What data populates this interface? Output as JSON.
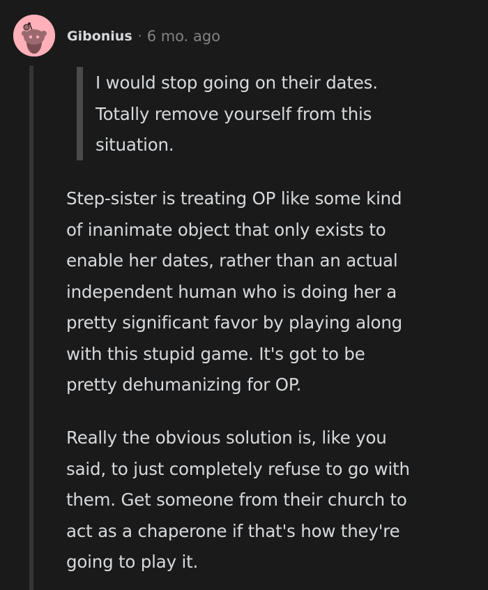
{
  "comment": {
    "author": "Gibonius",
    "separator": "·",
    "timestamp": "6 mo. ago",
    "avatar_icon": "reddit-snoo-avatar-icon",
    "avatar_color": "#ffb0b8",
    "quote_lines": [
      "I would stop going on their dates.",
      "Totally remove yourself from this",
      "situation."
    ],
    "paragraph1_lines": [
      "Step-sister is treating OP like some kind",
      "of inanimate object that only exists to",
      "enable her dates, rather than an actual",
      "independent human who is doing her a",
      "pretty significant favor by playing along",
      "with this stupid game. It's got to be",
      "pretty dehumanizing for OP."
    ],
    "paragraph2_lines": [
      "Really the obvious solution is, like you",
      "said, to just completely refuse to go with",
      "them. Get someone from their church to",
      "act as a chaperone if that's how they're",
      "going to play it."
    ]
  }
}
